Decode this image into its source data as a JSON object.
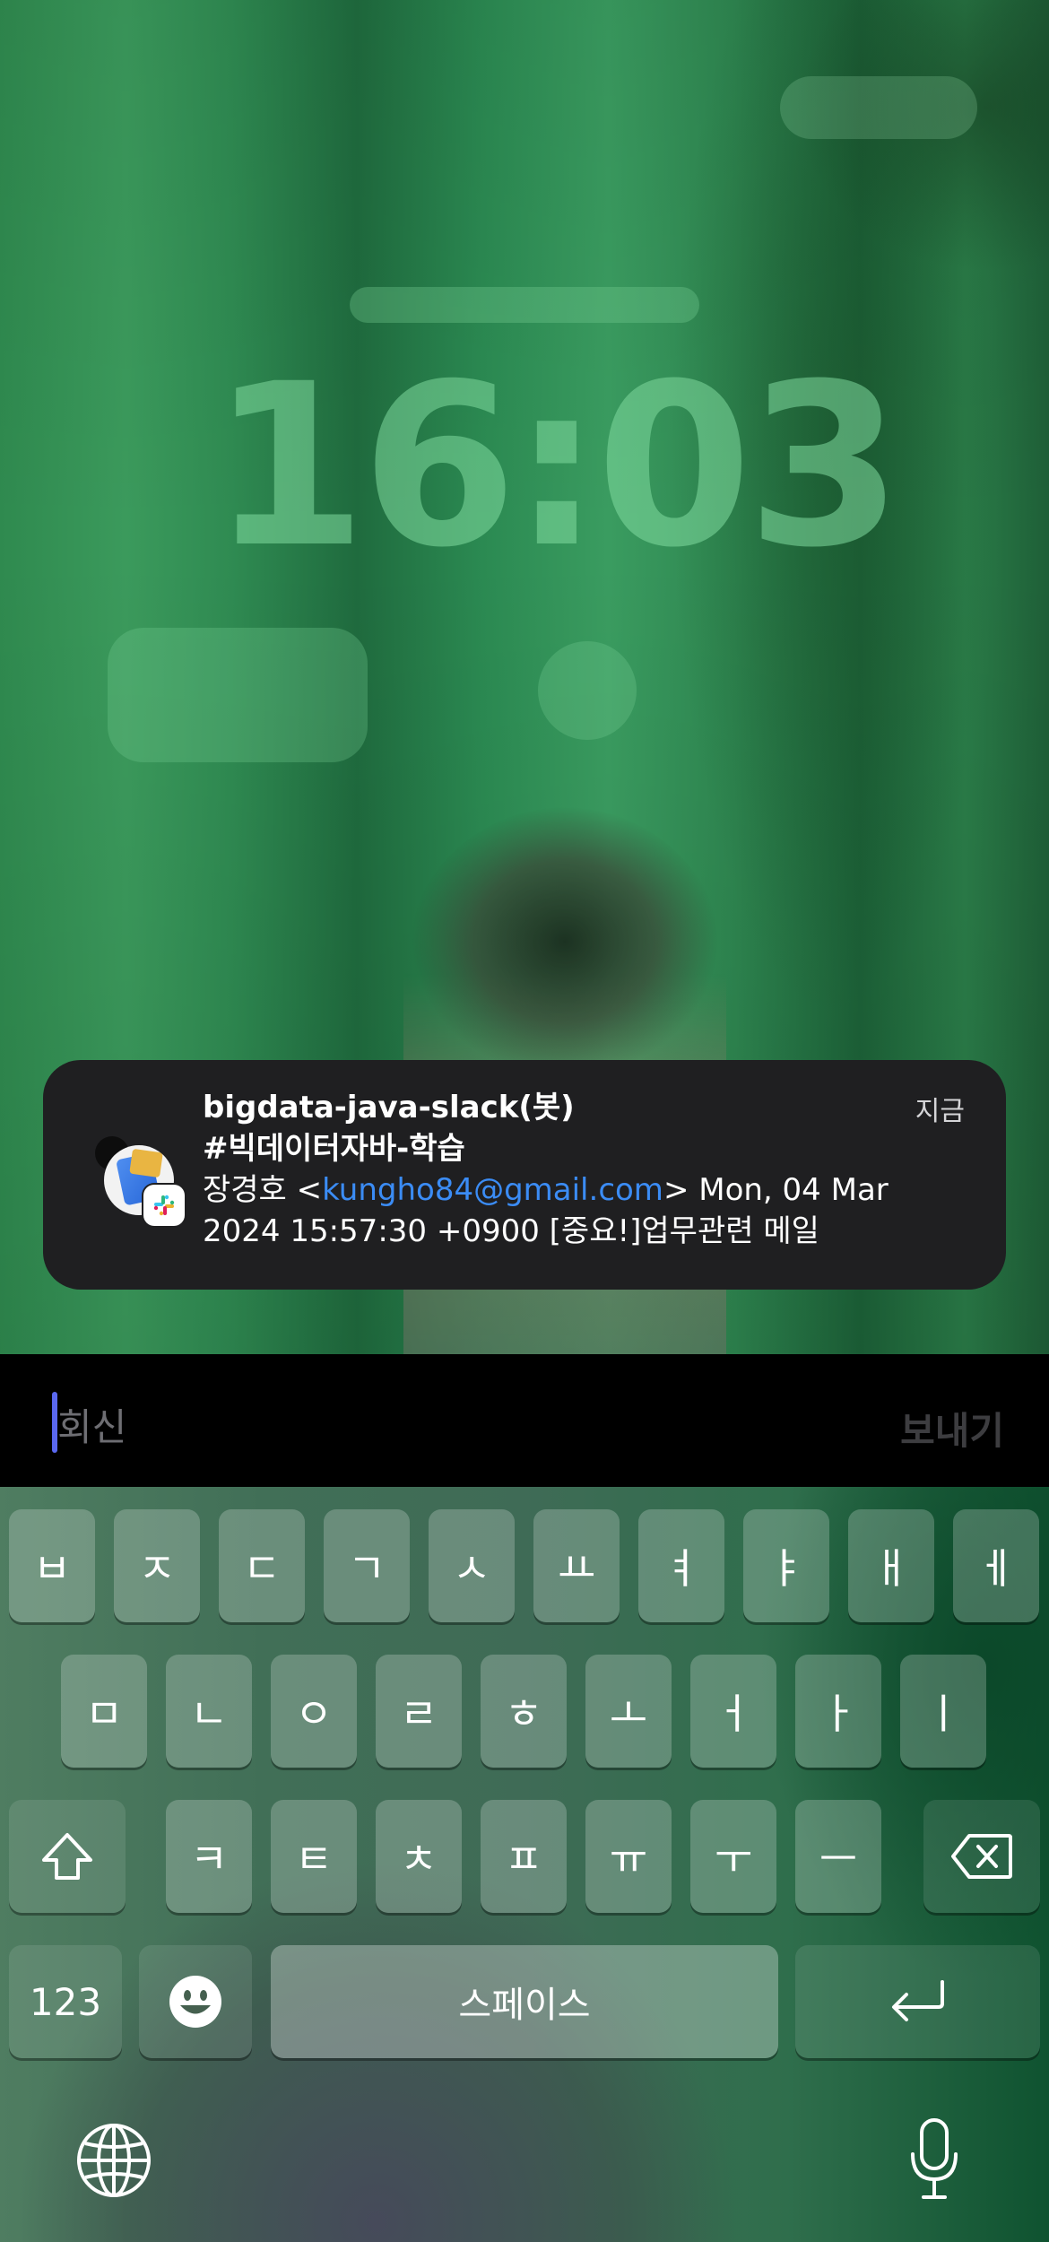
{
  "lockscreen": {
    "time": "16:03"
  },
  "notification": {
    "app": "Slack",
    "title_line1": "bigdata-java-slack(봇)",
    "title_line2": "#빅데이터자바-학습",
    "time": "지금",
    "body_prefix": "장경호 <",
    "body_email": "kungho84@gmail.com",
    "body_suffix": "> Mon, 04 Mar",
    "body_line2": "2024 15:57:30 +0900 [중요!]업무관련 메일"
  },
  "reply": {
    "placeholder": "회신",
    "send_label": "보내기"
  },
  "keyboard": {
    "row1": [
      "ㅂ",
      "ㅈ",
      "ㄷ",
      "ㄱ",
      "ㅅ",
      "ㅛ",
      "ㅕ",
      "ㅑ",
      "ㅐ",
      "ㅔ"
    ],
    "row2": [
      "ㅁ",
      "ㄴ",
      "ㅇ",
      "ㄹ",
      "ㅎ",
      "ㅗ",
      "ㅓ",
      "ㅏ",
      "ㅣ"
    ],
    "row3": [
      "ㅋ",
      "ㅌ",
      "ㅊ",
      "ㅍ",
      "ㅠ",
      "ㅜ",
      "ㅡ"
    ],
    "numbers_label": "123",
    "space_label": "스페이스"
  },
  "icons": {
    "shift": "shift-icon",
    "delete": "delete-icon",
    "emoji": "emoji-icon",
    "return": "return-icon",
    "globe": "globe-icon",
    "mic": "microphone-icon",
    "app_badge": "slack-icon"
  },
  "colors": {
    "link": "#3b8cf5",
    "caret": "#5a68f0",
    "card_bg": "#1f1f21"
  }
}
